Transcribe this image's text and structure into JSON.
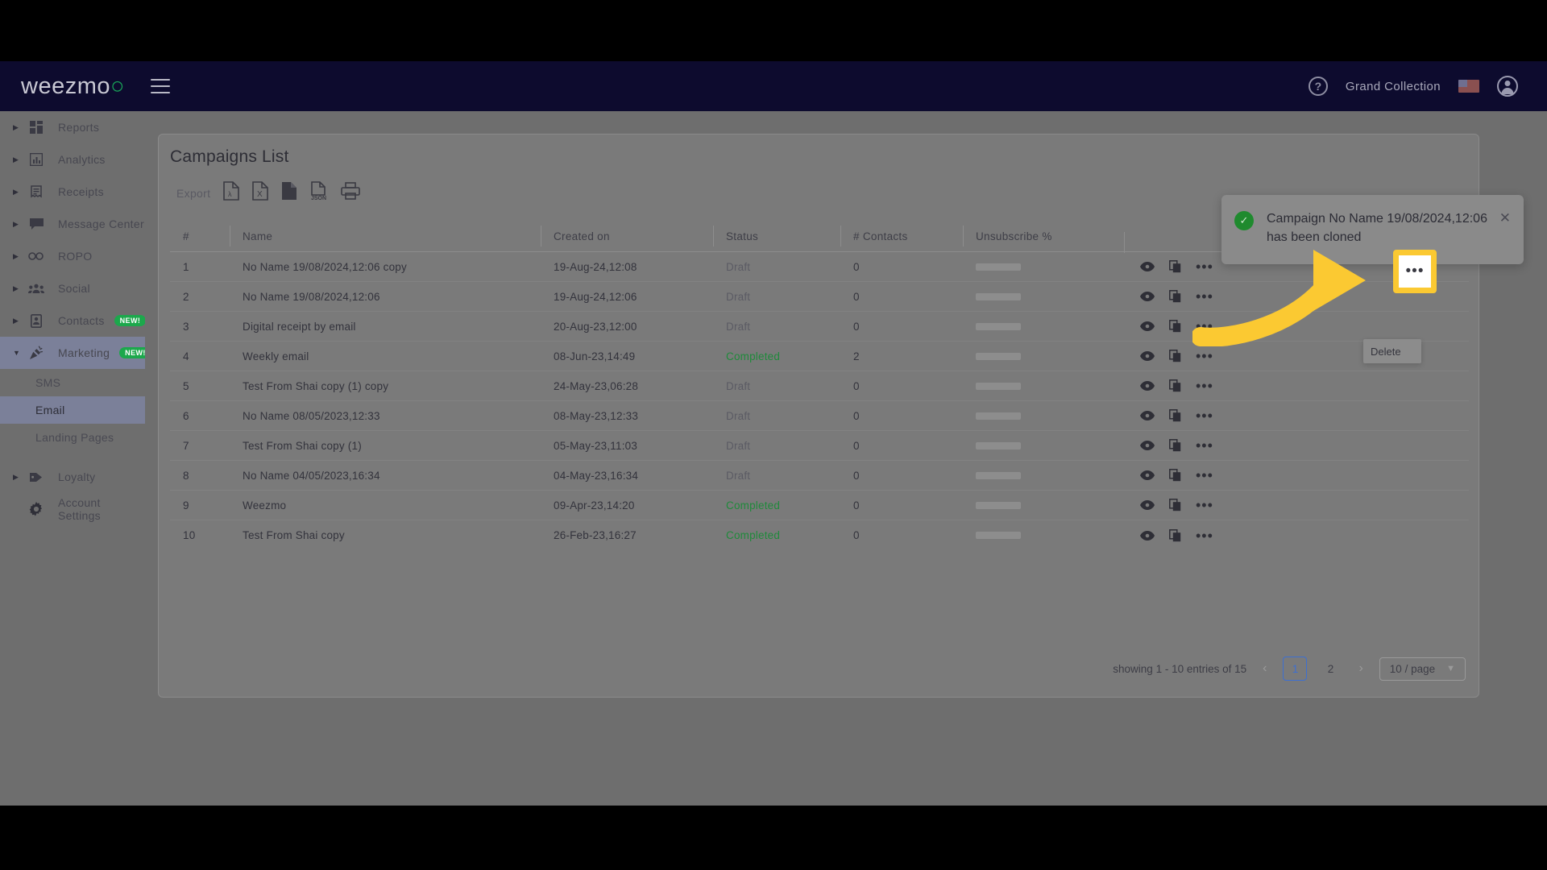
{
  "topbar": {
    "logo_text": "weezmo",
    "menu_icon": "hamburger-icon",
    "help_icon": "?",
    "account_name": "Grand Collection",
    "flag": "us-flag-icon",
    "avatar": "user-avatar-icon"
  },
  "sidebar": {
    "items": [
      {
        "label": "Reports",
        "icon": "grid-icon",
        "expanded": false,
        "badge": ""
      },
      {
        "label": "Analytics",
        "icon": "chart-icon",
        "expanded": false,
        "badge": ""
      },
      {
        "label": "Receipts",
        "icon": "receipt-icon",
        "expanded": false,
        "badge": ""
      },
      {
        "label": "Message Center",
        "icon": "message-icon",
        "expanded": false,
        "badge": ""
      },
      {
        "label": "ROPO",
        "icon": "infinity-icon",
        "expanded": false,
        "badge": ""
      },
      {
        "label": "Social",
        "icon": "people-icon",
        "expanded": false,
        "badge": ""
      },
      {
        "label": "Contacts",
        "icon": "contact-card-icon",
        "expanded": false,
        "badge": "NEW!"
      },
      {
        "label": "Marketing",
        "icon": "megaphone-icon",
        "expanded": true,
        "badge": "NEW!"
      }
    ],
    "marketing_children": [
      {
        "label": "SMS",
        "selected": false
      },
      {
        "label": "Email",
        "selected": true
      },
      {
        "label": "Landing Pages",
        "selected": false
      }
    ],
    "bottom_items": [
      {
        "label": "Loyalty",
        "icon": "tag-icon",
        "expanded": false
      },
      {
        "label": "Account Settings",
        "icon": "gear-icon",
        "expanded": false
      }
    ]
  },
  "card": {
    "title": "Campaigns List",
    "export": {
      "label": "Export",
      "options": [
        "pdf-export-icon",
        "excel-export-icon",
        "document-export-icon",
        "json-export-icon",
        "print-icon"
      ],
      "json_label": "JSON",
      "excel_label": "X"
    },
    "columns": [
      "#",
      "Name",
      "Created on",
      "Status",
      "# Contacts",
      "Unsubscribe %",
      ""
    ],
    "rows": [
      {
        "num": "1",
        "name": "No Name 19/08/2024,12:06 copy",
        "created": "19-Aug-24,12:08",
        "status": "Draft",
        "contacts": "0",
        "unsub": ""
      },
      {
        "num": "2",
        "name": "No Name 19/08/2024,12:06",
        "created": "19-Aug-24,12:06",
        "status": "Draft",
        "contacts": "0",
        "unsub": ""
      },
      {
        "num": "3",
        "name": "Digital receipt by email",
        "created": "20-Aug-23,12:00",
        "status": "Draft",
        "contacts": "0",
        "unsub": ""
      },
      {
        "num": "4",
        "name": "Weekly email",
        "created": "08-Jun-23,14:49",
        "status": "Completed",
        "contacts": "2",
        "unsub": ""
      },
      {
        "num": "5",
        "name": "Test From Shai copy (1) copy",
        "created": "24-May-23,06:28",
        "status": "Draft",
        "contacts": "0",
        "unsub": ""
      },
      {
        "num": "6",
        "name": "No Name 08/05/2023,12:33",
        "created": "08-May-23,12:33",
        "status": "Draft",
        "contacts": "0",
        "unsub": ""
      },
      {
        "num": "7",
        "name": "Test From Shai copy (1)",
        "created": "05-May-23,11:03",
        "status": "Draft",
        "contacts": "0",
        "unsub": ""
      },
      {
        "num": "8",
        "name": "No Name 04/05/2023,16:34",
        "created": "04-May-23,16:34",
        "status": "Draft",
        "contacts": "0",
        "unsub": ""
      },
      {
        "num": "9",
        "name": "Weezmo",
        "created": "09-Apr-23,14:20",
        "status": "Completed",
        "contacts": "0",
        "unsub": ""
      },
      {
        "num": "10",
        "name": "Test From Shai copy",
        "created": "26-Feb-23,16:27",
        "status": "Completed",
        "contacts": "0",
        "unsub": ""
      }
    ],
    "row_actions": [
      "preview-icon",
      "clone-icon",
      "more-options-icon"
    ],
    "pagination": {
      "showing": "showing 1 - 10 entries of 15",
      "prev": "‹",
      "pages": [
        "1",
        "2"
      ],
      "current_page": "1",
      "next": "›",
      "page_size": "10 / page"
    }
  },
  "toast": {
    "icon": "success-check-icon",
    "message": "Campaign No Name 19/08/2024,12:06 has been cloned",
    "close": "✕"
  },
  "annotation": {
    "highlight_target": "more-options-icon",
    "highlight_color": "#fbc932",
    "dots_glyph": "•••"
  },
  "context_menu": {
    "items": [
      "Delete"
    ]
  },
  "colors": {
    "topbar": "#0d0b2e",
    "accent_green": "#1ca84c",
    "completed": "#1f8a3b",
    "highlight": "#fbc932",
    "pager_active": "#3d6fd1"
  }
}
